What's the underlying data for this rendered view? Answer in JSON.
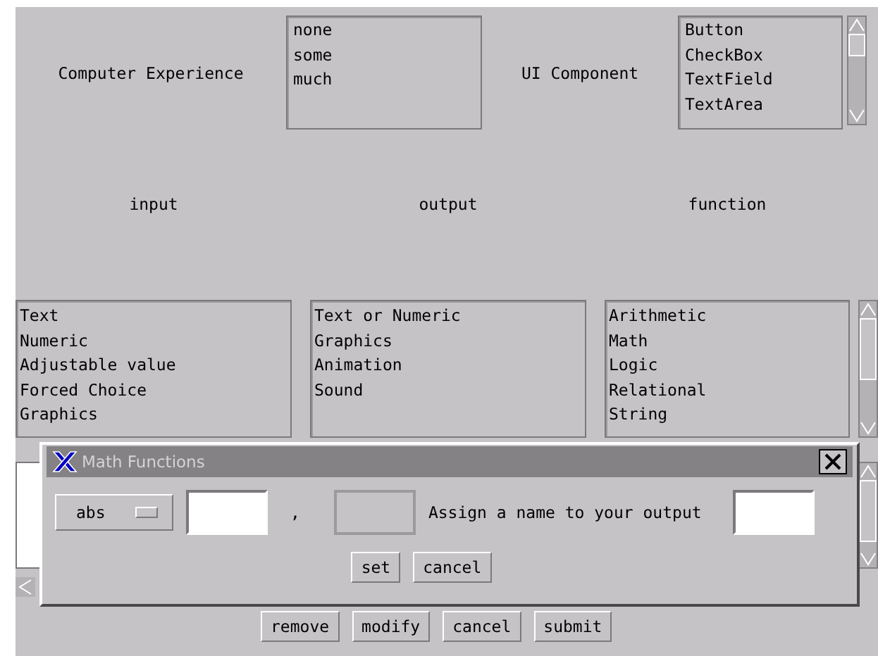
{
  "form": {
    "experience_label": "Computer Experience",
    "experience_options": [
      "none",
      "some",
      "much"
    ],
    "component_label": "UI Component",
    "component_options": [
      "Button",
      "CheckBox",
      "TextField",
      "TextArea"
    ]
  },
  "columns": [
    {
      "heading": "input",
      "items": [
        "Text",
        "Numeric",
        "Adjustable value",
        "Forced Choice",
        "Graphics"
      ]
    },
    {
      "heading": "output",
      "items": [
        "Text or Numeric",
        "Graphics",
        "Animation",
        "Sound"
      ]
    },
    {
      "heading": "function",
      "items": [
        "Arithmetic",
        "Math",
        "Logic",
        "Relational",
        "String"
      ]
    }
  ],
  "dialog": {
    "title": "Math Functions",
    "function_menu": "abs",
    "separator": ",",
    "arguments": [
      {
        "disabled": false
      },
      {
        "disabled": true
      }
    ],
    "output_label": "Assign a name to your output",
    "buttons": [
      "set",
      "cancel"
    ]
  },
  "buttons": [
    "remove",
    "modify",
    "cancel",
    "submit"
  ]
}
